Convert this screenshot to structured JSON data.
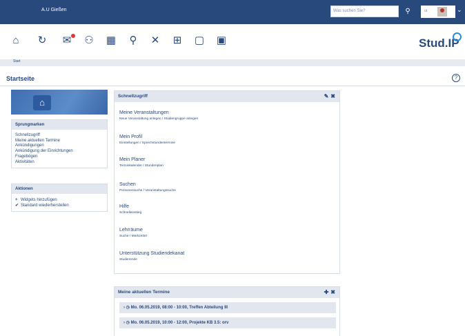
{
  "header": {
    "uni_name": "A.U Gießen",
    "search_placeholder": "Was suchen Sie?",
    "user_initials": "ut"
  },
  "nav": {
    "items": [
      {
        "name": "start",
        "icon": "home-icon",
        "label": "Start"
      },
      {
        "name": "news",
        "icon": "news-icon"
      },
      {
        "name": "messages",
        "icon": "mail-icon"
      },
      {
        "name": "community",
        "icon": "community-icon"
      },
      {
        "name": "schedule",
        "icon": "calendar-icon"
      },
      {
        "name": "search",
        "icon": "search-icon"
      },
      {
        "name": "tools",
        "icon": "tools-icon"
      },
      {
        "name": "admin",
        "icon": "admin-icon"
      },
      {
        "name": "files",
        "icon": "files-icon"
      },
      {
        "name": "content",
        "icon": "content-icon"
      }
    ],
    "logo_text": "Stud.IP"
  },
  "page": {
    "title": "Startseite"
  },
  "sidebar": {
    "sprungmarken_title": "Sprungmarken",
    "sprungmarken": [
      "Schnellzugriff",
      "Meine aktuellen Termine",
      "Ankündigungen",
      "Ankündigung der Einrichtungen",
      "Fragebögen",
      "Aktivitäten"
    ],
    "aktionen_title": "Aktionen",
    "aktionen": [
      {
        "icon": "+",
        "label": "Widgets hinzufügen"
      },
      {
        "icon": "✔",
        "label": "Standard wiederherstellen"
      }
    ]
  },
  "schnellzugriff": {
    "title": "Schnellzugriff",
    "items": [
      {
        "title": "Meine Veranstaltungen",
        "sub": "Neue Veranstaltung anlegen / Studiengruppe anlegen"
      },
      {
        "title": "Mein Profil",
        "sub": "Einstellungen / Sprechstundentermine"
      },
      {
        "title": "Mein Planer",
        "sub": "Terminkalender / Stundenplan"
      },
      {
        "title": "Suchen",
        "sub": "Personensuche / Veranstaltungssuche"
      },
      {
        "title": "Hilfe",
        "sub": "Schnelleinstieg"
      },
      {
        "title": "Lehrräume",
        "sub": "Suche / Merkzettel"
      },
      {
        "title": "Unterstützung Studiendekanat",
        "sub": "Studierende"
      }
    ]
  },
  "termine": {
    "title": "Meine aktuellen Termine",
    "rows": [
      "Mo. 06.05.2019, 08:00 - 10:00, Treffen Abteilung III",
      "Mo. 06.05.2019, 10:00 - 12:00, Projekte KB 3.5: orv"
    ]
  },
  "colors": {
    "brand": "#28497c",
    "panel_header": "#e2e6ee",
    "accent": "#2a8ad8"
  }
}
